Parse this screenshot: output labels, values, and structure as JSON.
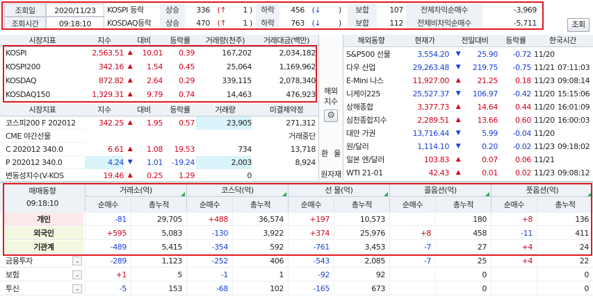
{
  "top": {
    "row1": {
      "label": "조회일",
      "date": "2020/11/23",
      "market": "KOSPI 등락",
      "up_label": "상승",
      "up": "336",
      "up_paren_open": "(↑",
      "up_count": "1",
      "up_paren_close": ")",
      "down_label": "하락",
      "down": "456",
      "down_paren_open": "(↓",
      "down_paren_close": ")",
      "flat_label": "보합",
      "flat": "107",
      "total_label": "전체차익순매수",
      "total": "-3,969"
    },
    "row2": {
      "label": "조회시간",
      "time": "09:18:10",
      "market": "KOSDAQ등락",
      "up_label": "상승",
      "up": "470",
      "up_paren_open": "(↑",
      "up_count": "1",
      "up_paren_close": ")",
      "down_label": "하락",
      "down": "763",
      "down_paren_open": "(↓",
      "down_paren_close": ")",
      "flat_label": "보합",
      "flat": "112",
      "total_label": "전체비차익순매수",
      "total": "-5,711"
    },
    "query_button": "조회"
  },
  "market": {
    "headers": [
      "시장지표",
      "지수",
      "대비",
      "등락률",
      "거래량(천주)",
      "거래대금(백만)"
    ],
    "rows": [
      {
        "name": "KOSPI",
        "index": "2,563.51",
        "arrow": "▲",
        "chg": "10.01",
        "rate": "0.39",
        "vol": "167,202",
        "amt": "2,034,182"
      },
      {
        "name": "KOSPI200",
        "index": "342.16",
        "arrow": "▲",
        "chg": "1.54",
        "rate": "0.45",
        "vol": "25,064",
        "amt": "1,169,962"
      },
      {
        "name": "KOSDAQ",
        "index": "872.82",
        "arrow": "▲",
        "chg": "2.64",
        "rate": "0.29",
        "vol": "339,115",
        "amt": "2,078,340"
      },
      {
        "name": "KOSDAQ150",
        "index": "1,329.31",
        "arrow": "▲",
        "chg": "9.79",
        "rate": "0.74",
        "vol": "14,463",
        "amt": "476,923"
      }
    ],
    "headers2": [
      "시장지표",
      "지수",
      "대비",
      "등락률",
      "거래량",
      "미결제약정"
    ],
    "rows2": [
      {
        "name": "코스피200 F 202012",
        "index": "342.25",
        "arrow": "▲",
        "chg": "1.95",
        "rate": "0.57",
        "vol": "23,905",
        "amt": "271,312",
        "color": "red"
      },
      {
        "name": "CME 야간선물",
        "index": "",
        "arrow": "",
        "chg": "",
        "rate": "",
        "vol": "",
        "amt": "거래중단",
        "color": "red"
      },
      {
        "name": "C 202012 340.0",
        "index": "6.61",
        "arrow": "▲",
        "chg": "1.08",
        "rate": "19.53",
        "vol": "734",
        "amt": "13,718",
        "color": "red"
      },
      {
        "name": "P 202012 340.0",
        "index": "4.24",
        "arrow": "▼",
        "chg": "1.01",
        "rate": "-19.24",
        "vol": "2,003",
        "amt": "8,924",
        "color": "blue"
      },
      {
        "name": "변동성지수(V-KOS",
        "index": "19.46",
        "arrow": "▲",
        "chg": "0.25",
        "rate": "1.29",
        "vol": "0",
        "amt": "",
        "color": "red"
      }
    ]
  },
  "side_labels": {
    "overseas1": "해외",
    "overseas2": "지수",
    "fx1": "환",
    "fx2": "율",
    "raw": "원자재"
  },
  "overseas": {
    "headers": [
      "해외동향",
      "현재가",
      "전일대비",
      "등락률",
      "한국시간"
    ],
    "rows": [
      {
        "name": "S&P500 선물",
        "price": "3,554.20",
        "arrow": "▼",
        "chg": "25.90",
        "rate": "-0.72",
        "date": "11/20",
        "time": "",
        "color": "blue"
      },
      {
        "name": "다우 산업",
        "price": "29,263.48",
        "arrow": "▼",
        "chg": "219.75",
        "rate": "-0.75",
        "date": "11/21",
        "time": "07:11:03",
        "color": "blue"
      },
      {
        "name": "E-Mini 나스",
        "price": "11,927.00",
        "arrow": "▲",
        "chg": "21.25",
        "rate": "0.18",
        "date": "11/23",
        "time": "09:08:14",
        "color": "red"
      },
      {
        "name": "니케이225",
        "price": "25,527.37",
        "arrow": "▼",
        "chg": "106.97",
        "rate": "-0.42",
        "date": "11/20",
        "time": "15:15:06",
        "color": "blue"
      },
      {
        "name": "상해종합",
        "price": "3,377.73",
        "arrow": "▲",
        "chg": "14.64",
        "rate": "0.44",
        "date": "11/20",
        "time": "16:01:09",
        "color": "red"
      },
      {
        "name": "심천종합지수",
        "price": "2,289.51",
        "arrow": "▲",
        "chg": "13.66",
        "rate": "0.60",
        "date": "11/20",
        "time": "16:00:03",
        "color": "red"
      },
      {
        "name": "대만 가권",
        "price": "13,716.44",
        "arrow": "▼",
        "chg": "5.99",
        "rate": "-0.04",
        "date": "11/20",
        "time": "",
        "color": "blue"
      },
      {
        "name": "원/달러",
        "price": "1,114.10",
        "arrow": "▼",
        "chg": "0.20",
        "rate": "-0.02",
        "date": "11/23",
        "time": "09:18:02",
        "color": "blue"
      },
      {
        "name": "일본 엔/달러",
        "price": "103.83",
        "arrow": "▲",
        "chg": "0.07",
        "rate": "0.06",
        "date": "11/21",
        "time": "",
        "color": "red"
      },
      {
        "name": "WTI 21-01",
        "price": "42.43",
        "arrow": "▲",
        "chg": "0.01",
        "rate": "0.02",
        "date": "11/23",
        "time": "09:08:12",
        "color": "red"
      }
    ]
  },
  "trading": {
    "title": "매매동향",
    "time": "09:18:10",
    "groups": [
      "거래소(억)",
      "코스닥(억)",
      "선  물(억)",
      "콜옵션(억)",
      "풋옵션(억)"
    ],
    "sub": [
      "순매수",
      "총누적"
    ],
    "rows": [
      {
        "name": "개인",
        "vals": [
          "-81",
          "29,705",
          "+488",
          "36,574",
          "+197",
          "10,573",
          "",
          "180",
          "+8",
          "136"
        ]
      },
      {
        "name": "외국인",
        "vals": [
          "+595",
          "5,083",
          "-130",
          "3,922",
          "+374",
          "25,976",
          "+8",
          "458",
          "-11",
          "411"
        ]
      },
      {
        "name": "기관계",
        "vals": [
          "-489",
          "5,415",
          "-354",
          "592",
          "-761",
          "3,453",
          "-7",
          "27",
          "+4",
          "24"
        ]
      },
      {
        "name": "금융투자",
        "vals": [
          "-289",
          "1,123",
          "-252",
          "406",
          "-543",
          "2,085",
          "-7",
          "25",
          "+4",
          "22"
        ]
      },
      {
        "name": "보험",
        "vals": [
          "+1",
          "5",
          "-1",
          "1",
          "-92",
          "92",
          "",
          "0",
          "",
          "0"
        ]
      },
      {
        "name": "투신",
        "vals": [
          "-5",
          "153",
          "-68",
          "102",
          "-165",
          "673",
          "",
          "0",
          "",
          "0"
        ]
      }
    ]
  },
  "colors": {
    "red": "#d0021b",
    "blue": "#1a3fd6",
    "highlight": "#e0161b",
    "header_bg": "#eef2f7"
  }
}
